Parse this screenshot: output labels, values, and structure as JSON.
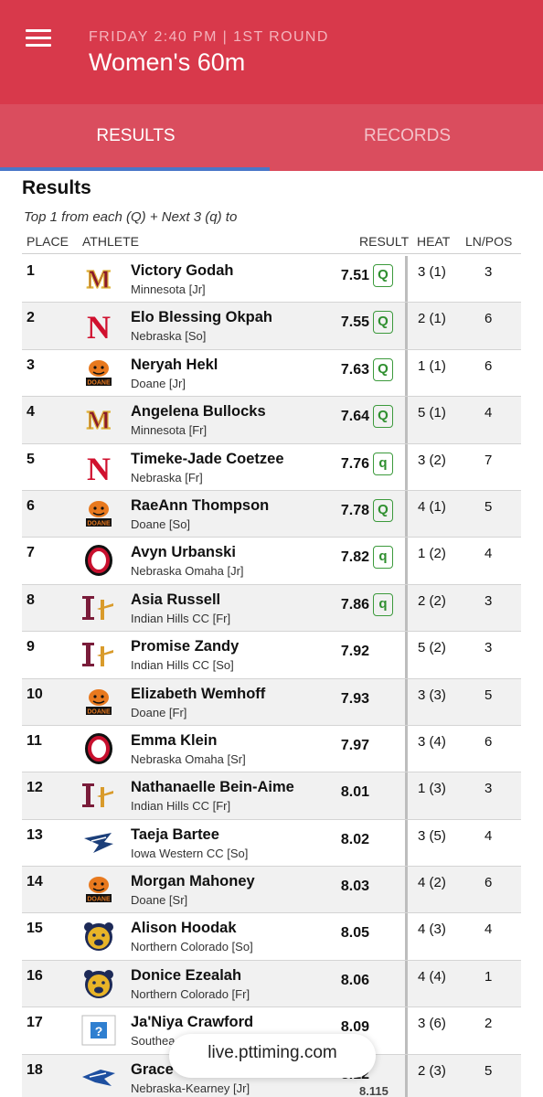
{
  "header": {
    "meta": "FRIDAY 2:40 PM | 1ST ROUND",
    "title": "Women's 60m"
  },
  "tabs": [
    {
      "label": "RESULTS",
      "active": true
    },
    {
      "label": "RECORDS",
      "active": false
    }
  ],
  "section": {
    "title": "Results",
    "qualification": "Top 1 from each (Q) + Next 3 (q) to"
  },
  "columns": {
    "place": "PLACE",
    "athlete": "ATHLETE",
    "result": "RESULT",
    "heat": "HEAT",
    "ln_pos": "LN/POS"
  },
  "results": [
    {
      "place": "1",
      "name": "Victory Godah",
      "school": "Minnesota [Jr]",
      "logo": "minnesota-logo",
      "result": "7.51",
      "q": "Q",
      "heat": "3 (1)",
      "ln_pos": "3"
    },
    {
      "place": "2",
      "name": "Elo Blessing Okpah",
      "school": "Nebraska [So]",
      "logo": "nebraska-logo",
      "result": "7.55",
      "q": "Q",
      "heat": "2 (1)",
      "ln_pos": "6"
    },
    {
      "place": "3",
      "name": "Neryah Hekl",
      "school": "Doane [Jr]",
      "logo": "doane-logo",
      "result": "7.63",
      "q": "Q",
      "heat": "1 (1)",
      "ln_pos": "6"
    },
    {
      "place": "4",
      "name": "Angelena Bullocks",
      "school": "Minnesota [Fr]",
      "logo": "minnesota-logo",
      "result": "7.64",
      "q": "Q",
      "heat": "5 (1)",
      "ln_pos": "4"
    },
    {
      "place": "5",
      "name": "Timeke-Jade Coetzee",
      "school": "Nebraska [Fr]",
      "logo": "nebraska-logo",
      "result": "7.76",
      "q": "q",
      "heat": "3 (2)",
      "ln_pos": "7"
    },
    {
      "place": "6",
      "name": "RaeAnn Thompson",
      "school": "Doane [So]",
      "logo": "doane-logo",
      "result": "7.78",
      "q": "Q",
      "heat": "4 (1)",
      "ln_pos": "5"
    },
    {
      "place": "7",
      "name": "Avyn Urbanski",
      "school": "Nebraska Omaha [Jr]",
      "logo": "omaha-logo",
      "result": "7.82",
      "q": "q",
      "heat": "1 (2)",
      "ln_pos": "4"
    },
    {
      "place": "8",
      "name": "Asia Russell",
      "school": "Indian Hills CC [Fr]",
      "logo": "indian-hills-logo",
      "result": "7.86",
      "q": "q",
      "heat": "2 (2)",
      "ln_pos": "3"
    },
    {
      "place": "9",
      "name": "Promise Zandy",
      "school": "Indian Hills CC [So]",
      "logo": "indian-hills-logo",
      "result": "7.92",
      "q": "",
      "heat": "5 (2)",
      "ln_pos": "3"
    },
    {
      "place": "10",
      "name": "Elizabeth Wemhoff",
      "school": "Doane [Fr]",
      "logo": "doane-logo",
      "result": "7.93",
      "q": "",
      "heat": "3 (3)",
      "ln_pos": "5"
    },
    {
      "place": "11",
      "name": "Emma Klein",
      "school": "Nebraska Omaha [Sr]",
      "logo": "omaha-logo",
      "result": "7.97",
      "q": "",
      "heat": "3 (4)",
      "ln_pos": "6"
    },
    {
      "place": "12",
      "name": "Nathanaelle Bein-Aime",
      "school": "Indian Hills CC [Fr]",
      "logo": "indian-hills-logo",
      "result": "8.01",
      "q": "",
      "heat": "1 (3)",
      "ln_pos": "3"
    },
    {
      "place": "13",
      "name": "Taeja Bartee",
      "school": "Iowa Western CC [So]",
      "logo": "iowa-western-logo",
      "result": "8.02",
      "q": "",
      "heat": "3 (5)",
      "ln_pos": "4"
    },
    {
      "place": "14",
      "name": "Morgan Mahoney",
      "school": "Doane [Sr]",
      "logo": "doane-logo",
      "result": "8.03",
      "q": "",
      "heat": "4 (2)",
      "ln_pos": "6"
    },
    {
      "place": "15",
      "name": "Alison Hoodak",
      "school": "Northern Colorado [So]",
      "logo": "northern-colorado-logo",
      "result": "8.05",
      "q": "",
      "heat": "4 (3)",
      "ln_pos": "4"
    },
    {
      "place": "16",
      "name": "Donice Ezealah",
      "school": "Northern Colorado [Fr]",
      "logo": "northern-colorado-logo",
      "result": "8.06",
      "q": "",
      "heat": "4 (4)",
      "ln_pos": "1"
    },
    {
      "place": "17",
      "name": "Ja'Niya Crawford",
      "school": "Southea",
      "logo": "unknown-logo",
      "result": "8.09",
      "q": "",
      "heat": "3 (6)",
      "ln_pos": "2"
    },
    {
      "place": "18",
      "name": "Grace",
      "school": "Nebraska-Kearney [Jr]",
      "logo": "kearney-logo",
      "result": "8.12",
      "q": "",
      "heat": "2 (3)",
      "ln_pos": "5"
    }
  ],
  "overlay": {
    "url": "live.pttiming.com",
    "extra_time": "8.115"
  },
  "colors": {
    "header_red": "#d8394b",
    "tab_red": "#da4d5e",
    "tab_indicator": "#4a77c8",
    "qualifier_green": "#3c9a3c"
  }
}
